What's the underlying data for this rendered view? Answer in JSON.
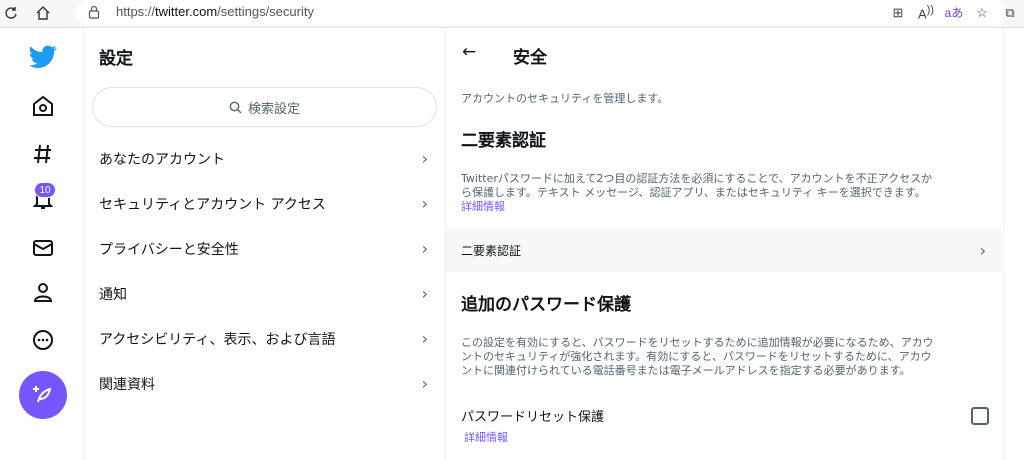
{
  "browser": {
    "url_prefix": "https://",
    "url_host": "twitter.com",
    "url_path": "/settings/security",
    "reader_label": "Aؙ",
    "translate_label": "aあ"
  },
  "nav": {
    "notifications_badge": "10",
    "accent": "#7856ff",
    "brand": "#1d9bf0"
  },
  "settings": {
    "title": "設定",
    "search_placeholder": "検索設定",
    "items": [
      {
        "label": "あなたのアカウント"
      },
      {
        "label": "セキュリティとアカウント アクセス"
      },
      {
        "label": "プライバシーと安全性"
      },
      {
        "label": "通知"
      },
      {
        "label": "アクセシビリティ、表示、および言語"
      },
      {
        "label": "関連資料"
      }
    ]
  },
  "detail": {
    "title": "安全",
    "lead": "アカウントのセキュリティを管理します。",
    "tfa_heading": "二要素認証",
    "tfa_desc_line1": "Twitterパスワードに加えて2つ目の認証方法を必須にすることで、アカウントを不正アクセスか",
    "tfa_desc_line2": "ら保護します。テキスト メッセージ、認証アプリ、またはセキュリティ キーを選択できます。",
    "tfa_link": "詳細情報",
    "tfa_row_label": "二要素認証",
    "pwd_heading": "追加のパスワード保護",
    "pwd_desc_line1": "この設定を有効にすると、パスワードをリセットするために追加情報が必要になるため、アカウ",
    "pwd_desc_line2": "ントのセキュリティが強化されます。有効にすると、パスワードをリセットするために、アカウ",
    "pwd_desc_line3": "ントに関連付けられている電話番号または電子メールアドレスを指定する必要があります。",
    "pwd_reset_label": "パスワードリセット保護",
    "pwd_reset_checked": false,
    "pwd_link": "詳細情報"
  }
}
